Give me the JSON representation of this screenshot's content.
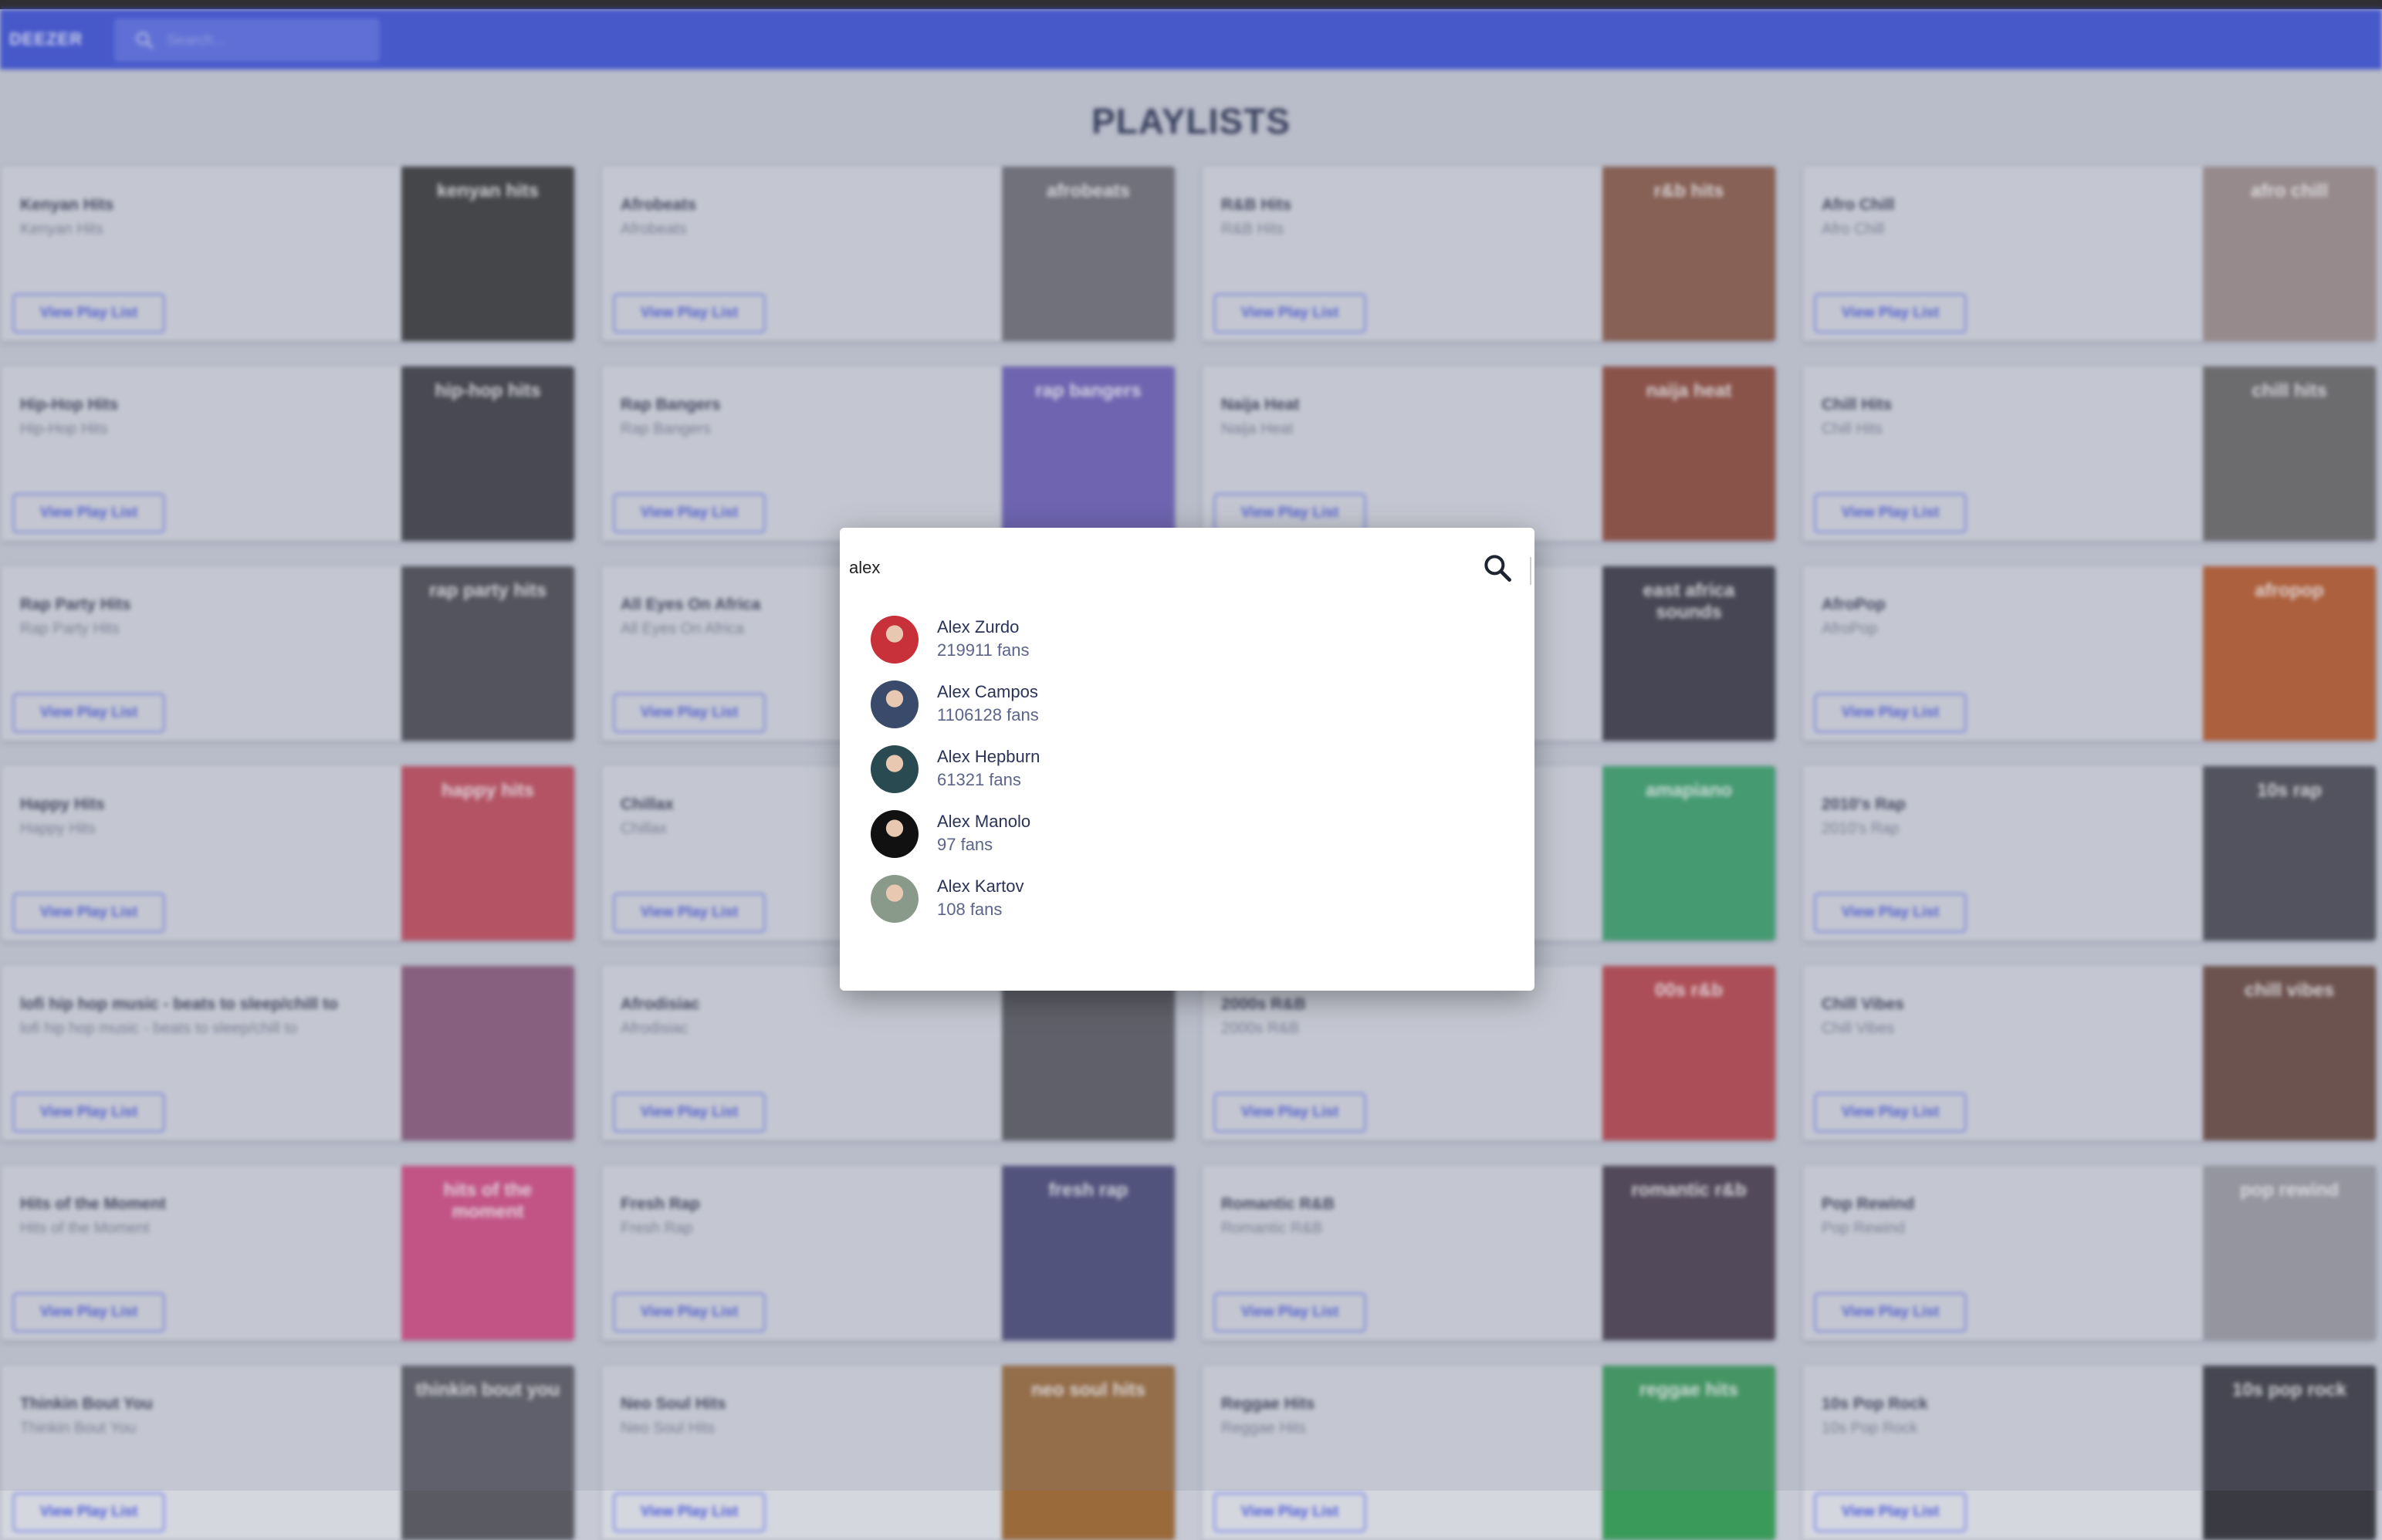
{
  "app": {
    "brand": "DEEZER"
  },
  "header": {
    "search_placeholder": "Search..."
  },
  "page": {
    "title": "PLAYLISTS"
  },
  "view_button_label": "View Play List",
  "playlists": [
    {
      "title": "Kenyan Hits",
      "subtitle": "Kenyan Hits",
      "cover_text": "kenyan hits",
      "cover_color": "#3a3a3a"
    },
    {
      "title": "Afrobeats",
      "subtitle": "Afrobeats",
      "cover_text": "afrobeats",
      "cover_color": "#6f6e76"
    },
    {
      "title": "R&B Hits",
      "subtitle": "R&B Hits",
      "cover_text": "r&b hits",
      "cover_color": "#8a5a48"
    },
    {
      "title": "Afro Chill",
      "subtitle": "Afro Chill",
      "cover_text": "afro chill",
      "cover_color": "#9e8d8a"
    },
    {
      "title": "Hip-Hop Hits",
      "subtitle": "Hip-Hop Hits",
      "cover_text": "hip-hop hits",
      "cover_color": "#3d3d44"
    },
    {
      "title": "Rap Bangers",
      "subtitle": "Rap Bangers",
      "cover_text": "rap bangers",
      "cover_color": "#6c5fb6"
    },
    {
      "title": "Naija Heat",
      "subtitle": "Naija Heat",
      "cover_text": "naija heat",
      "cover_color": "#8e4a3a"
    },
    {
      "title": "Chill Hits",
      "subtitle": "Chill Hits",
      "cover_text": "chill hits",
      "cover_color": "#6a6766"
    },
    {
      "title": "Rap Party Hits",
      "subtitle": "Rap Party Hits",
      "cover_text": "rap party hits",
      "cover_color": "#4b4b52"
    },
    {
      "title": "All Eyes On Africa",
      "subtitle": "All Eyes On Africa",
      "cover_text": "",
      "cover_color": "#d5d7df"
    },
    {
      "title": "",
      "subtitle": "",
      "cover_text": "east africa sounds",
      "cover_color": "#3c3a46"
    },
    {
      "title": "AfroPop",
      "subtitle": "AfroPop",
      "cover_text": "afropop",
      "cover_color": "#b85a2a"
    },
    {
      "title": "Happy Hits",
      "subtitle": "Happy Hits",
      "cover_text": "happy hits",
      "cover_color": "#c04a5a"
    },
    {
      "title": "Chillax",
      "subtitle": "Chillax",
      "cover_text": "",
      "cover_color": "#d5d7df"
    },
    {
      "title": "",
      "subtitle": "",
      "cover_text": "amapiano",
      "cover_color": "#3aa06a"
    },
    {
      "title": "2010's Rap",
      "subtitle": "2010's Rap",
      "cover_text": "10s rap",
      "cover_color": "#4a4a52"
    },
    {
      "title": "lofi hip hop music - beats to sleep/chill to",
      "subtitle": "lofi hip hop music - beats to sleep/chill to",
      "cover_text": "",
      "cover_color": "#8a5a7a"
    },
    {
      "title": "Afrodisiac",
      "subtitle": "Afrodisiac",
      "cover_text": "",
      "cover_color": "#5a5a60"
    },
    {
      "title": "2000s R&B",
      "subtitle": "2000s R&B",
      "cover_text": "00s r&b",
      "cover_color": "#b8444a"
    },
    {
      "title": "Chill Vibes",
      "subtitle": "Chill Vibes",
      "cover_text": "chill vibes",
      "cover_color": "#6a4a40"
    },
    {
      "title": "Hits of the Moment",
      "subtitle": "Hits of the Moment",
      "cover_text": "hits of the moment",
      "cover_color": "#d14a82"
    },
    {
      "title": "Fresh Rap",
      "subtitle": "Fresh Rap",
      "cover_text": "fresh rap",
      "cover_color": "#4a4a78"
    },
    {
      "title": "Romantic R&B",
      "subtitle": "Romantic R&B",
      "cover_text": "romantic r&b",
      "cover_color": "#4a3e4e"
    },
    {
      "title": "Pop Rewind",
      "subtitle": "Pop Rewind",
      "cover_text": "pop rewind",
      "cover_color": "#9a9aa2"
    },
    {
      "title": "Thinkin Bout You",
      "subtitle": "Thinkin Bout You",
      "cover_text": "thinkin bout you",
      "cover_color": "#5a5a62"
    },
    {
      "title": "Neo Soul Hits",
      "subtitle": "Neo Soul Hits",
      "cover_text": "neo soul hits",
      "cover_color": "#9a6a3a"
    },
    {
      "title": "Reggae Hits",
      "subtitle": "Reggae Hits",
      "cover_text": "reggae hits",
      "cover_color": "#3a9a5a"
    },
    {
      "title": "10s Pop Rock",
      "subtitle": "10s Pop Rock",
      "cover_text": "10s pop rock",
      "cover_color": "#3a3a42"
    }
  ],
  "search_modal": {
    "query": "alex",
    "results": [
      {
        "name": "Alex Zurdo",
        "fans": "219911 fans",
        "avatar_color": "#c8303a"
      },
      {
        "name": "Alex Campos",
        "fans": "1106128 fans",
        "avatar_color": "#3a4a6a"
      },
      {
        "name": "Alex Hepburn",
        "fans": "61321 fans",
        "avatar_color": "#2a4a52"
      },
      {
        "name": "Alex Manolo",
        "fans": "97 fans",
        "avatar_color": "#111111"
      },
      {
        "name": "Alex Kartov",
        "fans": "108 fans",
        "avatar_color": "#8a9a8a"
      }
    ]
  }
}
